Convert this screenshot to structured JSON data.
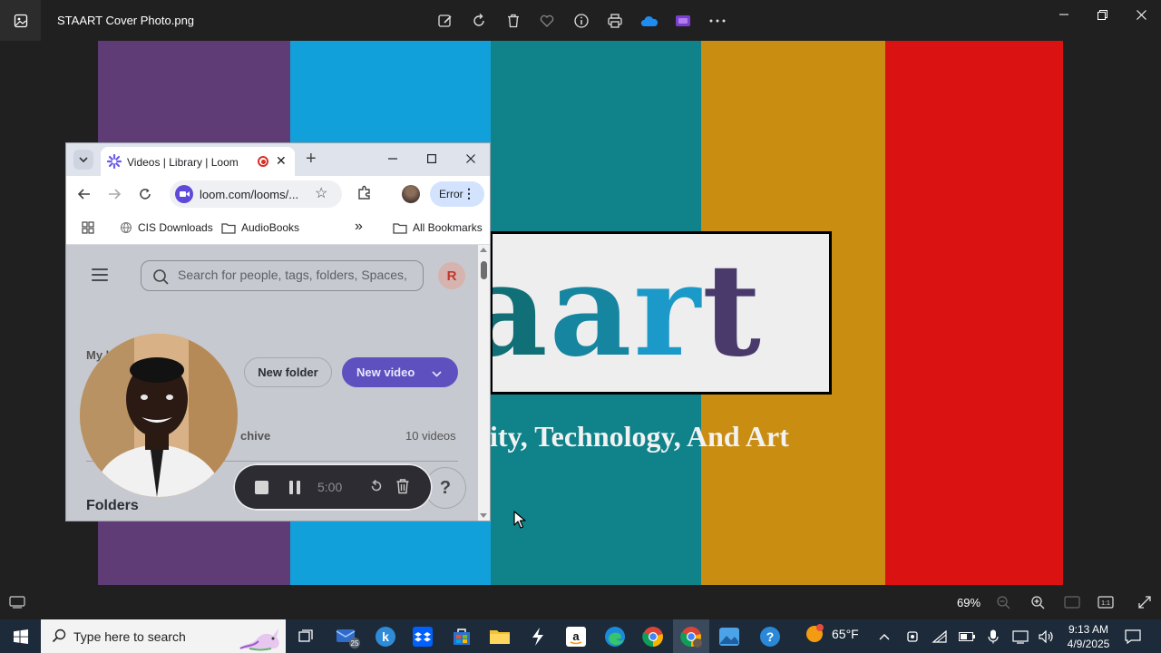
{
  "photos": {
    "file_title": "STAART Cover Photo.png",
    "tools": [
      "edit-image-icon",
      "rotate-icon",
      "delete-icon",
      "favorite-icon",
      "info-icon",
      "print-icon",
      "onedrive-icon",
      "clipchamp-icon",
      "more-icon"
    ],
    "zoom": "69%",
    "photo": {
      "stripe_colors": [
        "#5f3c76",
        "#12a0da",
        "#0f828a",
        "#c98d11",
        "#da1212"
      ],
      "logo_text": "aart",
      "tagline": "ity, Technology, And Art"
    }
  },
  "chrome": {
    "tab_title": "Videos | Library | Loom",
    "url": "loom.com/looms/...",
    "profile_chip": "Error",
    "bookmarks": [
      "CIS Downloads",
      "AudioBooks",
      "All Bookmarks"
    ],
    "more_bookmarks": "»"
  },
  "loom": {
    "search_placeholder": "Search for people, tags, folders, Spaces,",
    "avatar_initial": "R",
    "my_library_partial": "My l",
    "new_folder": "New folder",
    "new_video": "New video",
    "archive_partial": "chive",
    "video_count": "10 videos",
    "folders_heading": "Folders",
    "recorder_time": "5:00",
    "help": "?"
  },
  "taskbar": {
    "search_placeholder": "Type here to search",
    "mail_badge": "25",
    "weather": "65°F",
    "time": "9:13 AM",
    "date": "4/9/2025"
  },
  "colors": {
    "loom_accent": "#5f50bf",
    "taskbar_bg": "#1c2a3a",
    "app_bg": "#202020"
  }
}
